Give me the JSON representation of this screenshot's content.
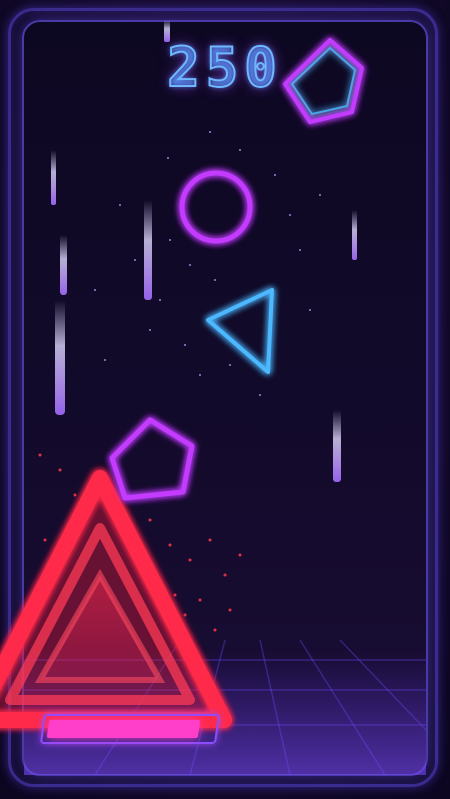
{
  "game": {
    "score": "250",
    "energy": 0.92
  },
  "colors": {
    "background": "#14082c",
    "frame": "#4a3aa8",
    "neon_purple": "#c23bff",
    "neon_blue": "#4bb8ff",
    "neon_red": "#ff2a4a",
    "energy_bar": "#ff3fc9"
  },
  "icons": [
    "pentagon-icon",
    "circle-icon",
    "triangle-icon",
    "pentagon-icon",
    "triangle-icon"
  ]
}
